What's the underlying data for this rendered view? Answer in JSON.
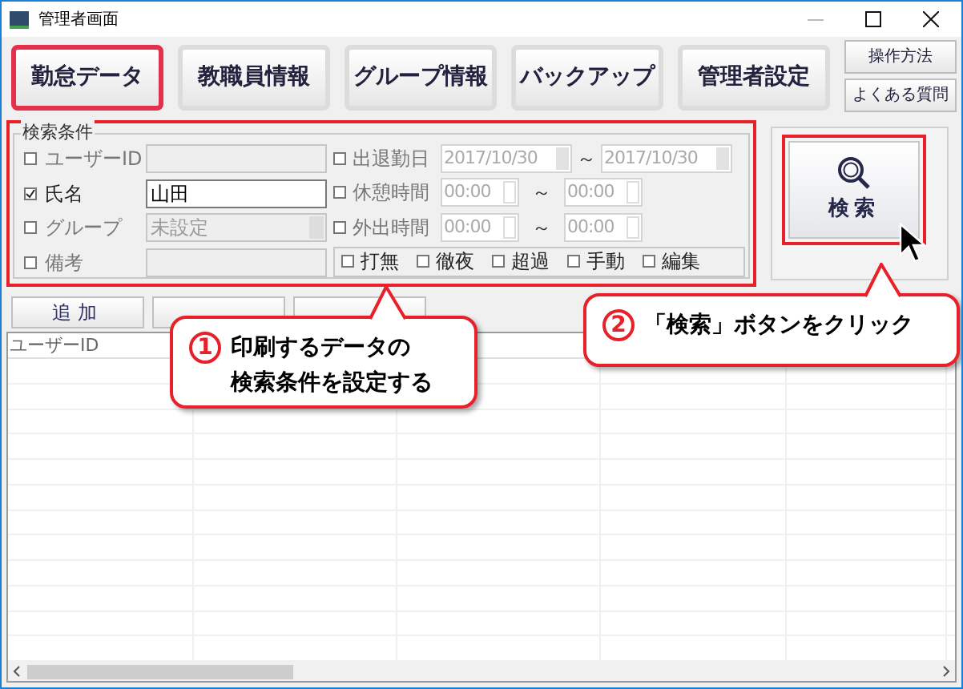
{
  "window": {
    "title": "管理者画面"
  },
  "nav_tabs": [
    {
      "label": "勤怠データ",
      "selected": true
    },
    {
      "label": "教職員情報",
      "selected": false
    },
    {
      "label": "グループ情報",
      "selected": false
    },
    {
      "label": "バックアップ",
      "selected": false
    },
    {
      "label": "管理者設定",
      "selected": false
    }
  ],
  "help_buttons": [
    "操作方法",
    "よくある質問"
  ],
  "search_conditions": {
    "title": "検索条件",
    "fields": [
      {
        "label": "ユーザーID",
        "checked": false,
        "kind": "text"
      },
      {
        "label": "氏名",
        "checked": true,
        "kind": "text",
        "value": "山田"
      },
      {
        "label": "グループ",
        "checked": false,
        "kind": "combo",
        "value": "未設定"
      },
      {
        "label": "備考",
        "checked": false,
        "kind": "text"
      }
    ],
    "ranges": [
      {
        "label": "出退勤日",
        "checked": false,
        "kind": "date",
        "from": "2017/10/30",
        "separator": "～",
        "to": "2017/10/30"
      },
      {
        "label": "休憩時間",
        "checked": false,
        "kind": "time",
        "from": "00:00",
        "separator": "～",
        "to": "00:00"
      },
      {
        "label": "外出時間",
        "checked": false,
        "kind": "time",
        "from": "00:00",
        "separator": "～",
        "to": "00:00"
      }
    ],
    "flags": [
      {
        "label": "打無",
        "checked": false
      },
      {
        "label": "徹夜",
        "checked": false
      },
      {
        "label": "超過",
        "checked": false
      },
      {
        "label": "手動",
        "checked": false
      },
      {
        "label": "編集",
        "checked": false
      }
    ]
  },
  "search_button": {
    "label": "検索"
  },
  "action_buttons": [
    {
      "kind": "labeled",
      "label": "追加"
    },
    {
      "kind": "covered"
    },
    {
      "kind": "covered"
    }
  ],
  "table": {
    "columns": [
      "ユーザーID"
    ]
  },
  "callouts": [
    {
      "number": "1",
      "lines": [
        "印刷するデータの",
        "検索条件を設定する"
      ]
    },
    {
      "number": "2",
      "lines": [
        "「検索」ボタンをクリック"
      ]
    }
  ]
}
